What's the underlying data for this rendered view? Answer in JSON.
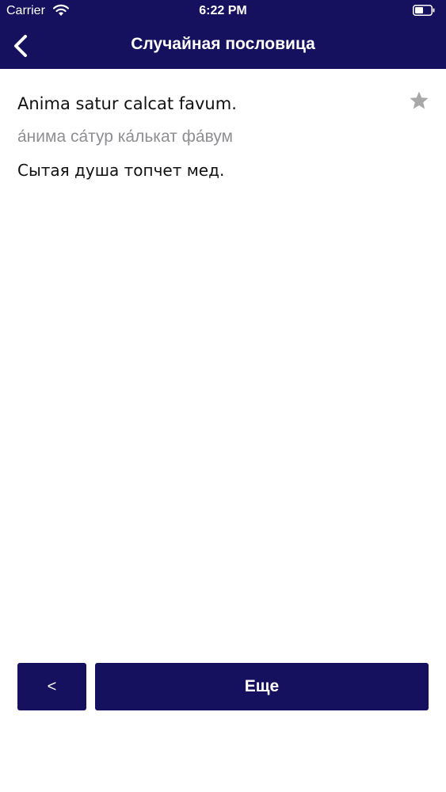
{
  "status_bar": {
    "carrier": "Carrier",
    "time": "6:22 PM",
    "wifi_icon": "wifi-icon",
    "battery_icon": "battery-icon"
  },
  "nav": {
    "back_icon": "chevron-left-icon",
    "title": "Случайная пословица"
  },
  "proverb": {
    "latin": "Anima satur calcat favum.",
    "transliteration": "а́нима са́тур ка́лькат фа́вум",
    "translation": "Сытая душа топчет мед.",
    "favorite_icon": "star-icon"
  },
  "buttons": {
    "prev_label": "<",
    "next_label": "Еще"
  },
  "colors": {
    "accent": "#15115f",
    "text": "#111111",
    "secondary_text": "#8e8e93",
    "star": "#a8a8a8"
  }
}
